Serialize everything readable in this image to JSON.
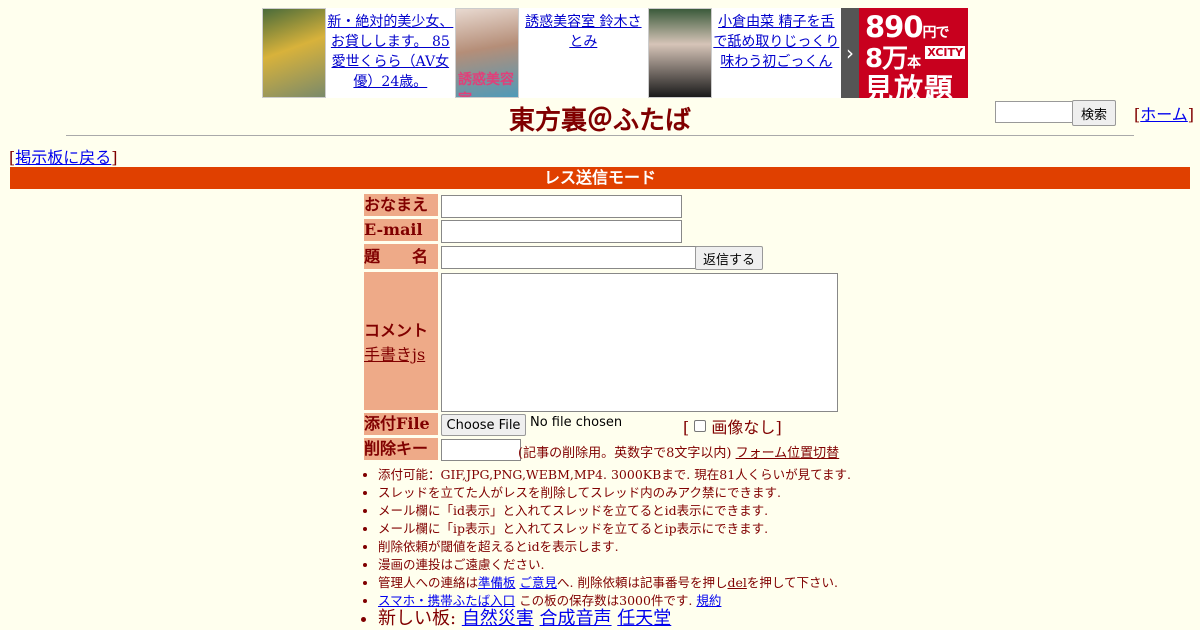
{
  "ads": [
    {
      "text": "新・絶対的美少女、お貸しします。 85 愛世くらら（AV女優）24歳。",
      "thumb_caption": ""
    },
    {
      "text": "誘惑美容室 鈴木さとみ",
      "thumb_caption": "誘惑美容室"
    },
    {
      "text": "小倉由菜 精子を舌で舐め取りじっくり味わう初ごっくん",
      "thumb_caption": ""
    }
  ],
  "promo": {
    "line1": "890",
    "line1_unit": "円で",
    "line2": "8万",
    "line2_unit": "本",
    "brand": "XCITY",
    "line3": "見放題"
  },
  "header": {
    "title": "東方裏＠ふたば",
    "search_button": "検索",
    "home_link": "ホーム"
  },
  "nav": {
    "back_link": "掲示板に戻る"
  },
  "form": {
    "mode_title": "レス送信モード",
    "name_label": "おなまえ",
    "email_label": "E-mail",
    "subject_label": "題　　名",
    "submit_button": "返信する",
    "comment_label": "コメント",
    "handwrite_link": "手書きjs",
    "file_label": "添付File",
    "file_button": "Choose File",
    "file_status": "No file chosen",
    "noimage_label": "画像なし",
    "delkey_label": "削除キー",
    "delkey_note": "(記事の削除用。英数字で8文字以内)",
    "form_toggle_link": "フォーム位置切替"
  },
  "notes": [
    {
      "text": "添付可能：GIF,JPG,PNG,WEBM,MP4. 3000KBまで. 現在81人くらいが見てます."
    },
    {
      "text": "スレッドを立てた人がレスを削除してスレッド内のみアク禁にできます."
    },
    {
      "text": "メール欄に「id表示」と入れてスレッドを立てるとid表示にできます."
    },
    {
      "text": "メール欄に「ip表示」と入れてスレッドを立てるとip表示にできます."
    },
    {
      "text": "削除依頼が閾値を超えるとidを表示します."
    },
    {
      "text": "漫画の連投はご遠慮ください."
    }
  ],
  "contact": {
    "prefix": "管理人への連絡は",
    "link1": "準備板",
    "link2": "ご意見",
    "mid": "へ. 削除依頼は記事番号を押し",
    "del": "del",
    "suffix": "を押して下さい."
  },
  "mobile": {
    "link": "スマホ・携帯ふたば入口",
    "text": "この板の保存数は3000件です.",
    "rules_link": "規約"
  },
  "new_boards": {
    "label": "新しい板:",
    "boards": [
      "自然災害",
      "合成音声",
      "任天堂"
    ]
  }
}
